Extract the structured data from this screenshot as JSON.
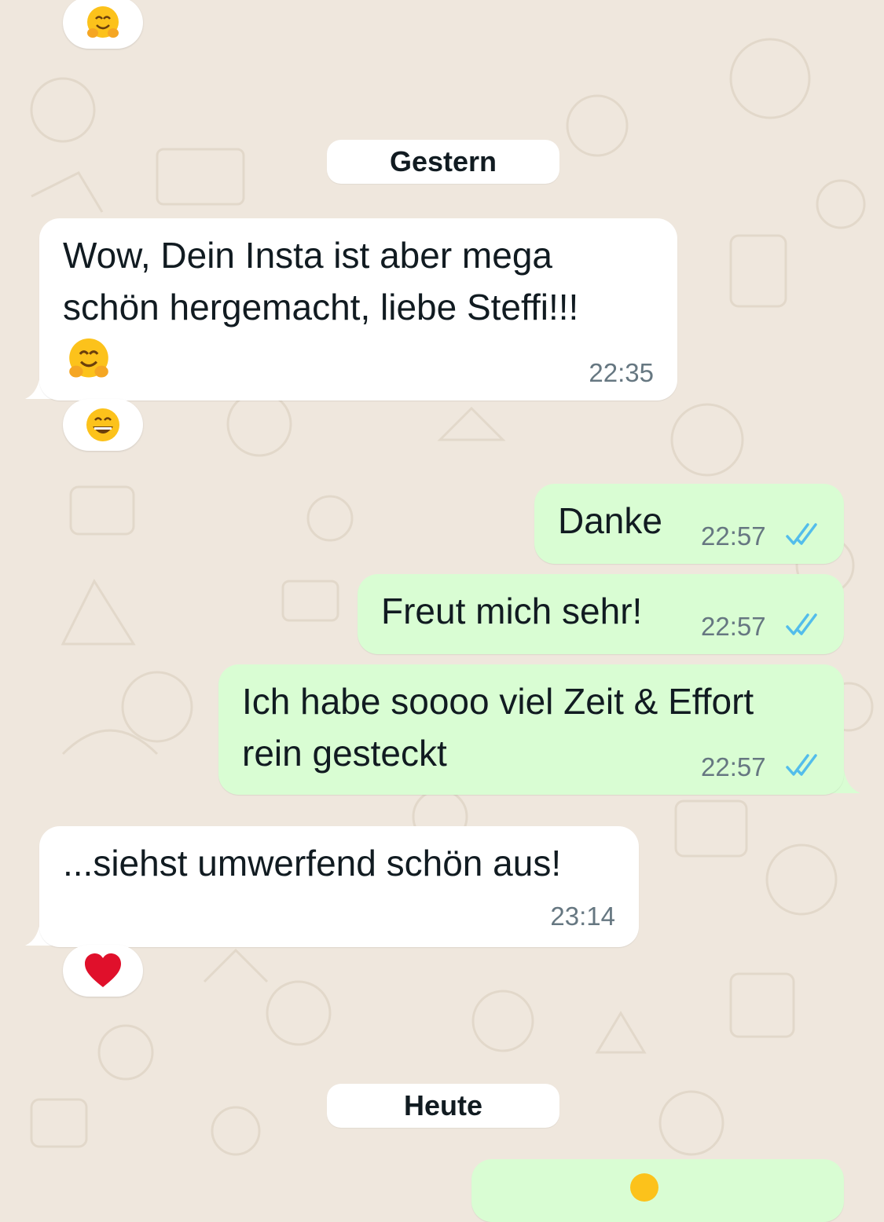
{
  "chat": {
    "date_separators": {
      "yesterday": "Gestern",
      "today": "Heute"
    },
    "messages": [
      {
        "direction": "incoming",
        "lines": [
          "Wow, Dein Insta ist aber mega",
          "schön hergemacht, liebe Steffi!!!"
        ],
        "emoji": "hugging-face",
        "time": "22:35",
        "reaction": "grinning-face"
      },
      {
        "direction": "outgoing",
        "text": "Danke",
        "time": "22:57",
        "status": "read"
      },
      {
        "direction": "outgoing",
        "text": "Freut mich sehr!",
        "time": "22:57",
        "status": "read"
      },
      {
        "direction": "outgoing",
        "lines": [
          "Ich habe soooo viel Zeit & Effort",
          "rein gesteckt"
        ],
        "time": "22:57",
        "status": "read"
      },
      {
        "direction": "incoming",
        "text": "...siehst umwerfend schön aus!",
        "time": "23:14",
        "reaction": "red-heart"
      }
    ],
    "top_reaction": "hugging-face"
  },
  "colors": {
    "background": "#efe7dd",
    "incoming_bubble": "#ffffff",
    "outgoing_bubble": "#d9fdd3",
    "read_ticks": "#53bdeb",
    "timestamp": "#667781"
  }
}
